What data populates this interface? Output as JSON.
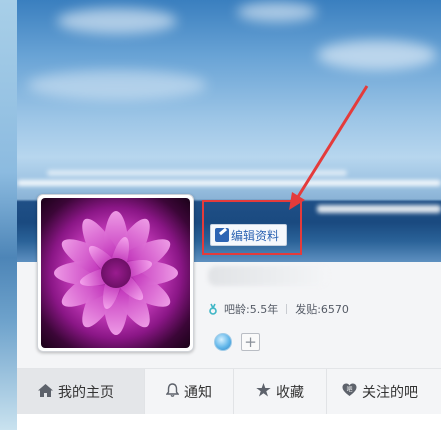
{
  "profile": {
    "edit_button_label": "编辑资料",
    "stats": {
      "bar_age": "吧龄:5.5年",
      "posts": "发贴:6570"
    },
    "add_badge_symbol": "+"
  },
  "tabs": [
    {
      "label": "我的主页",
      "icon": "home-icon",
      "active": true
    },
    {
      "label": "通知",
      "icon": "bell-icon",
      "active": false
    },
    {
      "label": "收藏",
      "icon": "star-icon",
      "active": false
    },
    {
      "label": "关注的吧",
      "icon": "heart-icon",
      "active": false
    }
  ],
  "colors": {
    "accent_blue": "#2d64b3",
    "annotation_red": "#e43b3b",
    "active_tab_bg": "#e4e6e9"
  }
}
